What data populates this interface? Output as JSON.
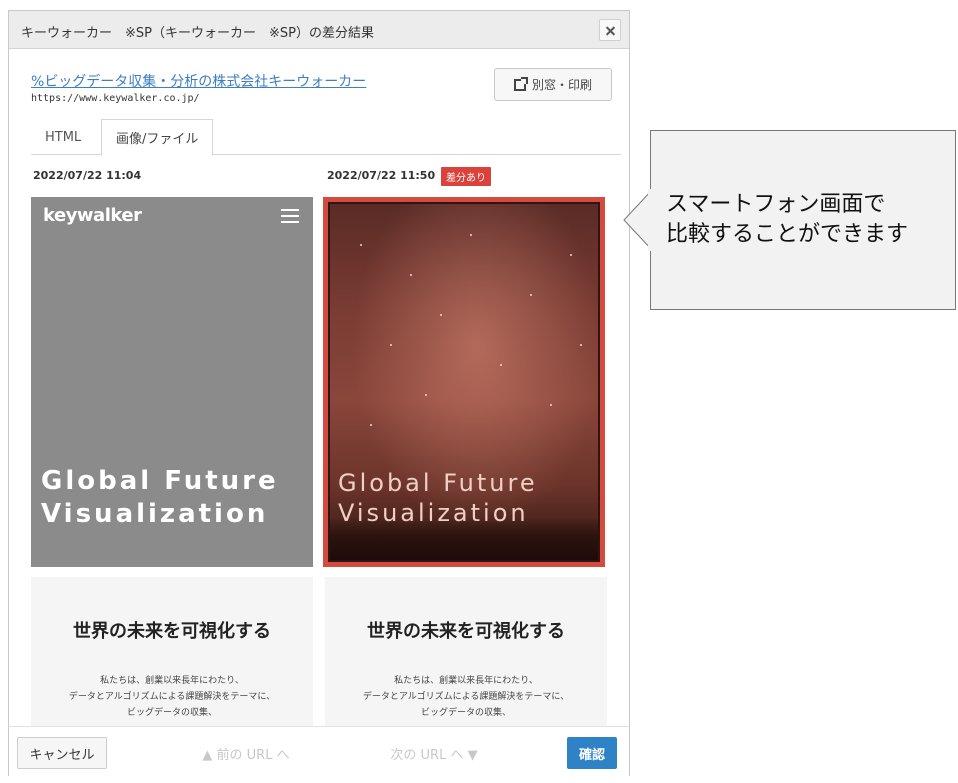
{
  "dialog": {
    "title": "キーウォーカー　※SP（キーウォーカー　※SP）の差分結果",
    "site_link": "ビッグデータ収集・分析の株式会社キーウォーカー",
    "site_url": "https://www.keywalker.co.jp/",
    "new_window_label": "別窓・印刷",
    "tabs": [
      {
        "label": "HTML",
        "active": false
      },
      {
        "label": "画像/ファイル",
        "active": true
      }
    ]
  },
  "comparison": {
    "left": {
      "date": "2022/07/22 11:04",
      "logo": "keywalker",
      "hero_line1": "Global Future",
      "hero_line2": "Visualization",
      "section_title": "世界の未来を可視化する",
      "body_line1": "私たちは、創業以来長年にわたり、",
      "body_line2": "データとアルゴリズムによる課題解決をテーマに、",
      "body_line3": "ビッグデータの収集、"
    },
    "right": {
      "date": "2022/07/22 11:50",
      "badge": "差分あり",
      "hero_line1": "Global Future",
      "hero_line2": "Visualization",
      "section_title": "世界の未来を可視化する",
      "body_line1": "私たちは、創業以来長年にわたり、",
      "body_line2": "データとアルゴリズムによる課題解決をテーマに、",
      "body_line3": "ビッグデータの収集、"
    }
  },
  "footer": {
    "cancel_label": "キャンセル",
    "prev_label": "▲ 前の URL へ",
    "next_label": "次の URL へ ▼",
    "confirm_label": "確認"
  },
  "callout": {
    "line1": "スマートフォン画面で",
    "line2": "比較することができます"
  },
  "colors": {
    "accent": "#2e82c6",
    "diff": "#d9433b",
    "link": "#3b7ec4"
  }
}
